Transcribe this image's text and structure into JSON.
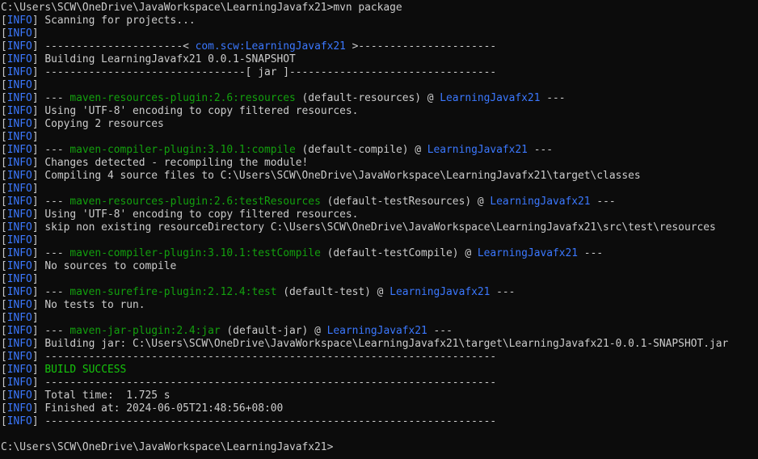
{
  "terminal": {
    "lines": [
      {
        "segments": [
          {
            "t": "C:\\Users\\SCW\\OneDrive\\JavaWorkspace\\LearningJavafx21>mvn package",
            "c": "text"
          }
        ]
      },
      {
        "info": true,
        "segments": [
          {
            "t": " Scanning for projects...",
            "c": "text"
          }
        ]
      },
      {
        "info": true,
        "segments": []
      },
      {
        "info": true,
        "segments": [
          {
            "t": " ----------------------< ",
            "c": "text"
          },
          {
            "t": "com.scw:LearningJavafx21",
            "c": "project"
          },
          {
            "t": " >----------------------",
            "c": "text"
          }
        ]
      },
      {
        "info": true,
        "segments": [
          {
            "t": " Building LearningJavafx21 0.0.1-SNAPSHOT",
            "c": "text"
          }
        ]
      },
      {
        "info": true,
        "segments": [
          {
            "t": " --------------------------------[ jar ]---------------------------------",
            "c": "text"
          }
        ]
      },
      {
        "info": true,
        "segments": []
      },
      {
        "info": true,
        "segments": [
          {
            "t": " --- ",
            "c": "text"
          },
          {
            "t": "maven-resources-plugin:2.6:resources",
            "c": "plugin"
          },
          {
            "t": " (default-resources) @ ",
            "c": "text"
          },
          {
            "t": "LearningJavafx21",
            "c": "project"
          },
          {
            "t": " ---",
            "c": "text"
          }
        ]
      },
      {
        "info": true,
        "segments": [
          {
            "t": " Using 'UTF-8' encoding to copy filtered resources.",
            "c": "text"
          }
        ]
      },
      {
        "info": true,
        "segments": [
          {
            "t": " Copying 2 resources",
            "c": "text"
          }
        ]
      },
      {
        "info": true,
        "segments": []
      },
      {
        "info": true,
        "segments": [
          {
            "t": " --- ",
            "c": "text"
          },
          {
            "t": "maven-compiler-plugin:3.10.1:compile",
            "c": "plugin"
          },
          {
            "t": " (default-compile) @ ",
            "c": "text"
          },
          {
            "t": "LearningJavafx21",
            "c": "project"
          },
          {
            "t": " ---",
            "c": "text"
          }
        ]
      },
      {
        "info": true,
        "segments": [
          {
            "t": " Changes detected - recompiling the module!",
            "c": "text"
          }
        ]
      },
      {
        "info": true,
        "segments": [
          {
            "t": " Compiling 4 source files to C:\\Users\\SCW\\OneDrive\\JavaWorkspace\\LearningJavafx21\\target\\classes",
            "c": "text"
          }
        ]
      },
      {
        "info": true,
        "segments": []
      },
      {
        "info": true,
        "segments": [
          {
            "t": " --- ",
            "c": "text"
          },
          {
            "t": "maven-resources-plugin:2.6:testResources",
            "c": "plugin"
          },
          {
            "t": " (default-testResources) @ ",
            "c": "text"
          },
          {
            "t": "LearningJavafx21",
            "c": "project"
          },
          {
            "t": " ---",
            "c": "text"
          }
        ]
      },
      {
        "info": true,
        "segments": [
          {
            "t": " Using 'UTF-8' encoding to copy filtered resources.",
            "c": "text"
          }
        ]
      },
      {
        "info": true,
        "segments": [
          {
            "t": " skip non existing resourceDirectory C:\\Users\\SCW\\OneDrive\\JavaWorkspace\\LearningJavafx21\\src\\test\\resources",
            "c": "text"
          }
        ]
      },
      {
        "info": true,
        "segments": []
      },
      {
        "info": true,
        "segments": [
          {
            "t": " --- ",
            "c": "text"
          },
          {
            "t": "maven-compiler-plugin:3.10.1:testCompile",
            "c": "plugin"
          },
          {
            "t": " (default-testCompile) @ ",
            "c": "text"
          },
          {
            "t": "LearningJavafx21",
            "c": "project"
          },
          {
            "t": " ---",
            "c": "text"
          }
        ]
      },
      {
        "info": true,
        "segments": [
          {
            "t": " No sources to compile",
            "c": "text"
          }
        ]
      },
      {
        "info": true,
        "segments": []
      },
      {
        "info": true,
        "segments": [
          {
            "t": " --- ",
            "c": "text"
          },
          {
            "t": "maven-surefire-plugin:2.12.4:test",
            "c": "plugin"
          },
          {
            "t": " (default-test) @ ",
            "c": "text"
          },
          {
            "t": "LearningJavafx21",
            "c": "project"
          },
          {
            "t": " ---",
            "c": "text"
          }
        ]
      },
      {
        "info": true,
        "segments": [
          {
            "t": " No tests to run.",
            "c": "text"
          }
        ]
      },
      {
        "info": true,
        "segments": []
      },
      {
        "info": true,
        "segments": [
          {
            "t": " --- ",
            "c": "text"
          },
          {
            "t": "maven-jar-plugin:2.4:jar",
            "c": "plugin"
          },
          {
            "t": " (default-jar) @ ",
            "c": "text"
          },
          {
            "t": "LearningJavafx21",
            "c": "project"
          },
          {
            "t": " ---",
            "c": "text"
          }
        ]
      },
      {
        "info": true,
        "segments": [
          {
            "t": " Building jar: C:\\Users\\SCW\\OneDrive\\JavaWorkspace\\LearningJavafx21\\target\\LearningJavafx21-0.0.1-SNAPSHOT.jar",
            "c": "text"
          }
        ]
      },
      {
        "info": true,
        "segments": [
          {
            "t": " ------------------------------------------------------------------------",
            "c": "text"
          }
        ]
      },
      {
        "info": true,
        "segments": [
          {
            "t": " ",
            "c": "text"
          },
          {
            "t": "BUILD SUCCESS",
            "c": "success"
          }
        ]
      },
      {
        "info": true,
        "segments": [
          {
            "t": " ------------------------------------------------------------------------",
            "c": "text"
          }
        ]
      },
      {
        "info": true,
        "segments": [
          {
            "t": " Total time:  1.725 s",
            "c": "text"
          }
        ]
      },
      {
        "info": true,
        "segments": [
          {
            "t": " Finished at: 2024-06-05T21:48:56+08:00",
            "c": "text"
          }
        ]
      },
      {
        "info": true,
        "segments": [
          {
            "t": " ------------------------------------------------------------------------",
            "c": "text"
          }
        ]
      },
      {
        "segments": []
      },
      {
        "segments": [
          {
            "t": "C:\\Users\\SCW\\OneDrive\\JavaWorkspace\\LearningJavafx21>",
            "c": "text"
          }
        ]
      }
    ],
    "info_label": "INFO",
    "colors": {
      "background": "#0c0c0c",
      "text": "#cccccc",
      "info_tag": "#3b78ff",
      "plugin": "#13a10e",
      "project": "#3b78ff",
      "success": "#16c60c"
    }
  }
}
